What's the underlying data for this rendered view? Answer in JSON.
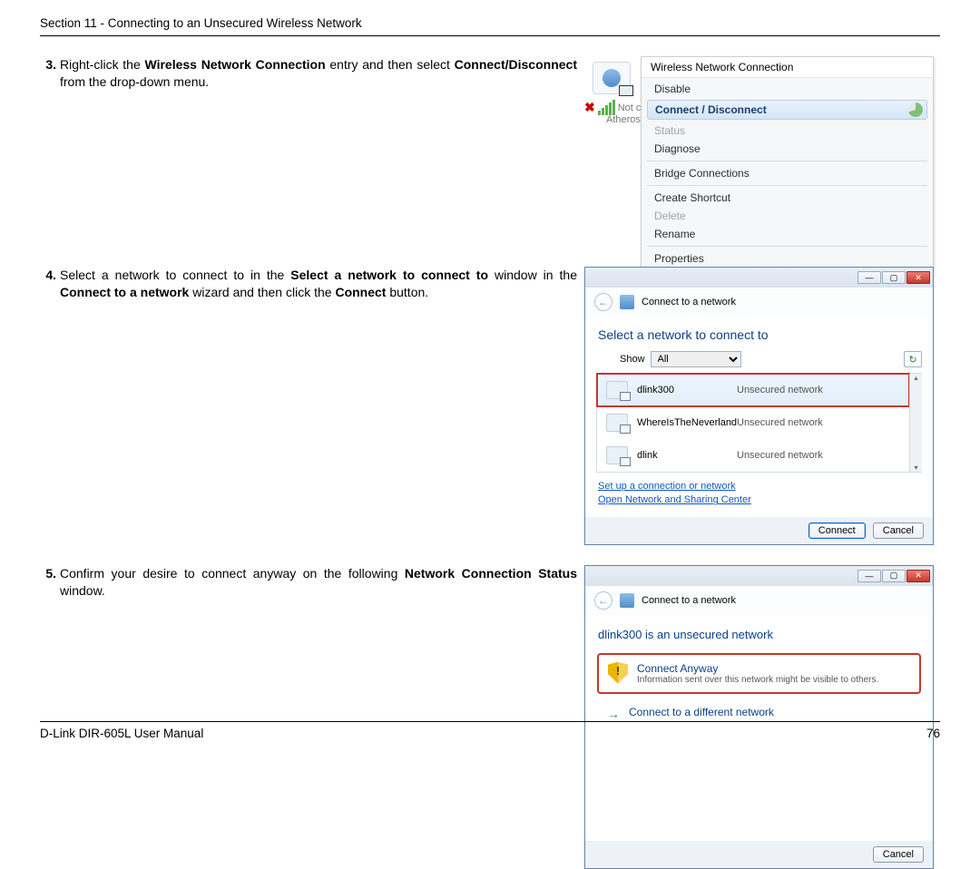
{
  "header": {
    "section": "Section 11 - Connecting to an Unsecured Wireless Network"
  },
  "footer": {
    "manual": "D-Link DIR-605L User Manual",
    "page": "76"
  },
  "steps": {
    "s3": {
      "num": "3.",
      "p1a": "Right-click the ",
      "b1": "Wireless Network Connection",
      "p1b": " entry and then select ",
      "b2": "Connect/Disconnect",
      "p1c": " from the drop-down menu."
    },
    "s4": {
      "num": "4.",
      "p1a": "Select a network to connect to in the ",
      "b1": "Select a network to connect to",
      "p1b": " window in the ",
      "b2": "Connect to a network",
      "p1c": " wizard and then click the ",
      "b3": "Connect",
      "p1d": " button."
    },
    "s5": {
      "num": "5.",
      "p1a": "Confirm your desire to connect anyway on the following ",
      "b1": "Network Connection Status",
      "p1b": " window."
    }
  },
  "fig1": {
    "title": "Wireless Network Connection",
    "notconn": "Not con",
    "adapter": "Atheros",
    "menu": {
      "disable": "Disable",
      "connect": "Connect / Disconnect",
      "status": "Status",
      "diagnose": "Diagnose",
      "bridge": "Bridge Connections",
      "shortcut": "Create Shortcut",
      "delete": "Delete",
      "rename": "Rename",
      "properties": "Properties"
    }
  },
  "fig2": {
    "wiztitle": "Connect to a network",
    "prompt": "Select a network to connect to",
    "show_lbl": "Show",
    "show_val": "All",
    "networks": [
      {
        "name": "dlink300",
        "type": "Unsecured network"
      },
      {
        "name": "WhereIsTheNeverland",
        "type": "Unsecured network"
      },
      {
        "name": "dlink",
        "type": "Unsecured network"
      }
    ],
    "link1": "Set up a connection or network",
    "link2": "Open Network and Sharing Center",
    "btn_connect": "Connect",
    "btn_cancel": "Cancel"
  },
  "fig3": {
    "wiztitle": "Connect to a network",
    "prompt": "dlink300 is an unsecured network",
    "opt1_t": "Connect Anyway",
    "opt1_d": "Information sent over this network might be visible to others.",
    "opt2_t": "Connect to a different network",
    "btn_cancel": "Cancel"
  }
}
